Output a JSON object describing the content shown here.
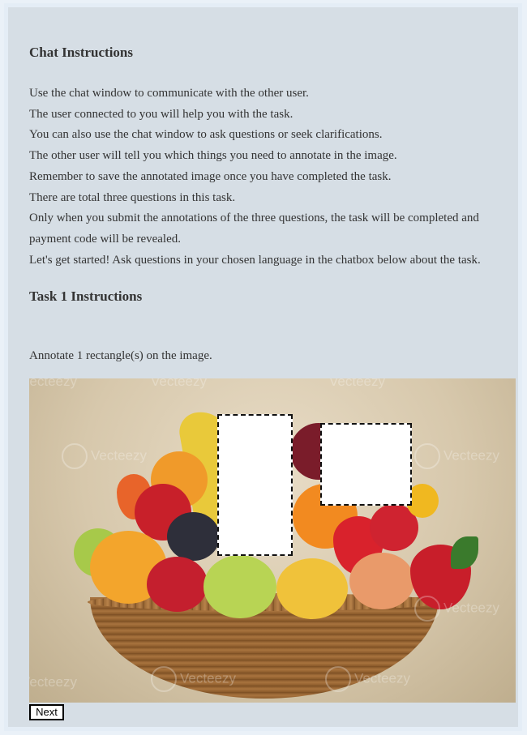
{
  "chat": {
    "heading": "Chat Instructions",
    "lines": [
      "Use the chat window to communicate with the other user.",
      "The user connected to you will help you with the task.",
      "You can also use the chat window to ask questions or seek clarifications.",
      "The other user will tell you which things you need to annotate in the image.",
      "Remember to save the annotated image once you have completed the task.",
      "There are total three questions in this task.",
      "Only when you submit the annotations of the three questions, the task will be completed and payment code will be revealed.",
      "Let's get started! Ask questions in your chosen language in the chatbox below about the task."
    ]
  },
  "task": {
    "heading": "Task 1 Instructions",
    "instruction": "Annotate 1 rectangle(s) on the image."
  },
  "image": {
    "description": "fruit-basket-photo",
    "watermark": "Vecteezy"
  },
  "controls": {
    "next_label": "Next"
  },
  "colors": {
    "panel_bg": "#d6dee5",
    "frame_bg": "#eaf1f8",
    "text": "#333333"
  }
}
